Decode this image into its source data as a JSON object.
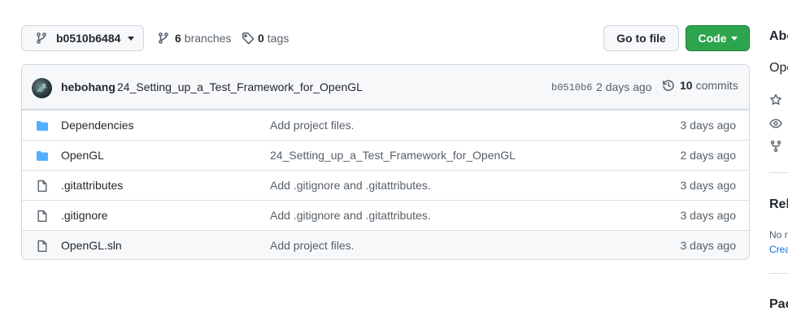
{
  "toolbar": {
    "branch_name": "b0510b6484",
    "branches_count": "6",
    "branches_label": "branches",
    "tags_count": "0",
    "tags_label": "tags",
    "goto_file_label": "Go to file",
    "code_label": "Code"
  },
  "commit": {
    "author": "hebohang",
    "message": "24_Setting_up_a_Test_Framework_for_OpenGL",
    "sha": "b0510b6",
    "age": "2 days ago",
    "commits_count": "10",
    "commits_label": "commits"
  },
  "files": [
    {
      "type": "folder",
      "name": "Dependencies",
      "message": "Add project files.",
      "age": "3 days ago"
    },
    {
      "type": "folder",
      "name": "OpenGL",
      "message": "24_Setting_up_a_Test_Framework_for_OpenGL",
      "age": "2 days ago"
    },
    {
      "type": "file",
      "name": ".gitattributes",
      "message": "Add .gitignore and .gitattributes.",
      "age": "3 days ago"
    },
    {
      "type": "file",
      "name": ".gitignore",
      "message": "Add .gitignore and .gitattributes.",
      "age": "3 days ago"
    },
    {
      "type": "file",
      "name": "OpenGL.sln",
      "message": "Add project files.",
      "age": "3 days ago"
    }
  ],
  "sidebar": {
    "about_heading": "Abo",
    "about_text": "Ope",
    "releases_heading": "Rel",
    "no_releases_text": "No r",
    "create_release_link": "Crea",
    "packages_heading": "Pac"
  },
  "colors": {
    "folder_icon": "#54aeff",
    "code_button": "#2da44e",
    "link": "#0969da"
  }
}
